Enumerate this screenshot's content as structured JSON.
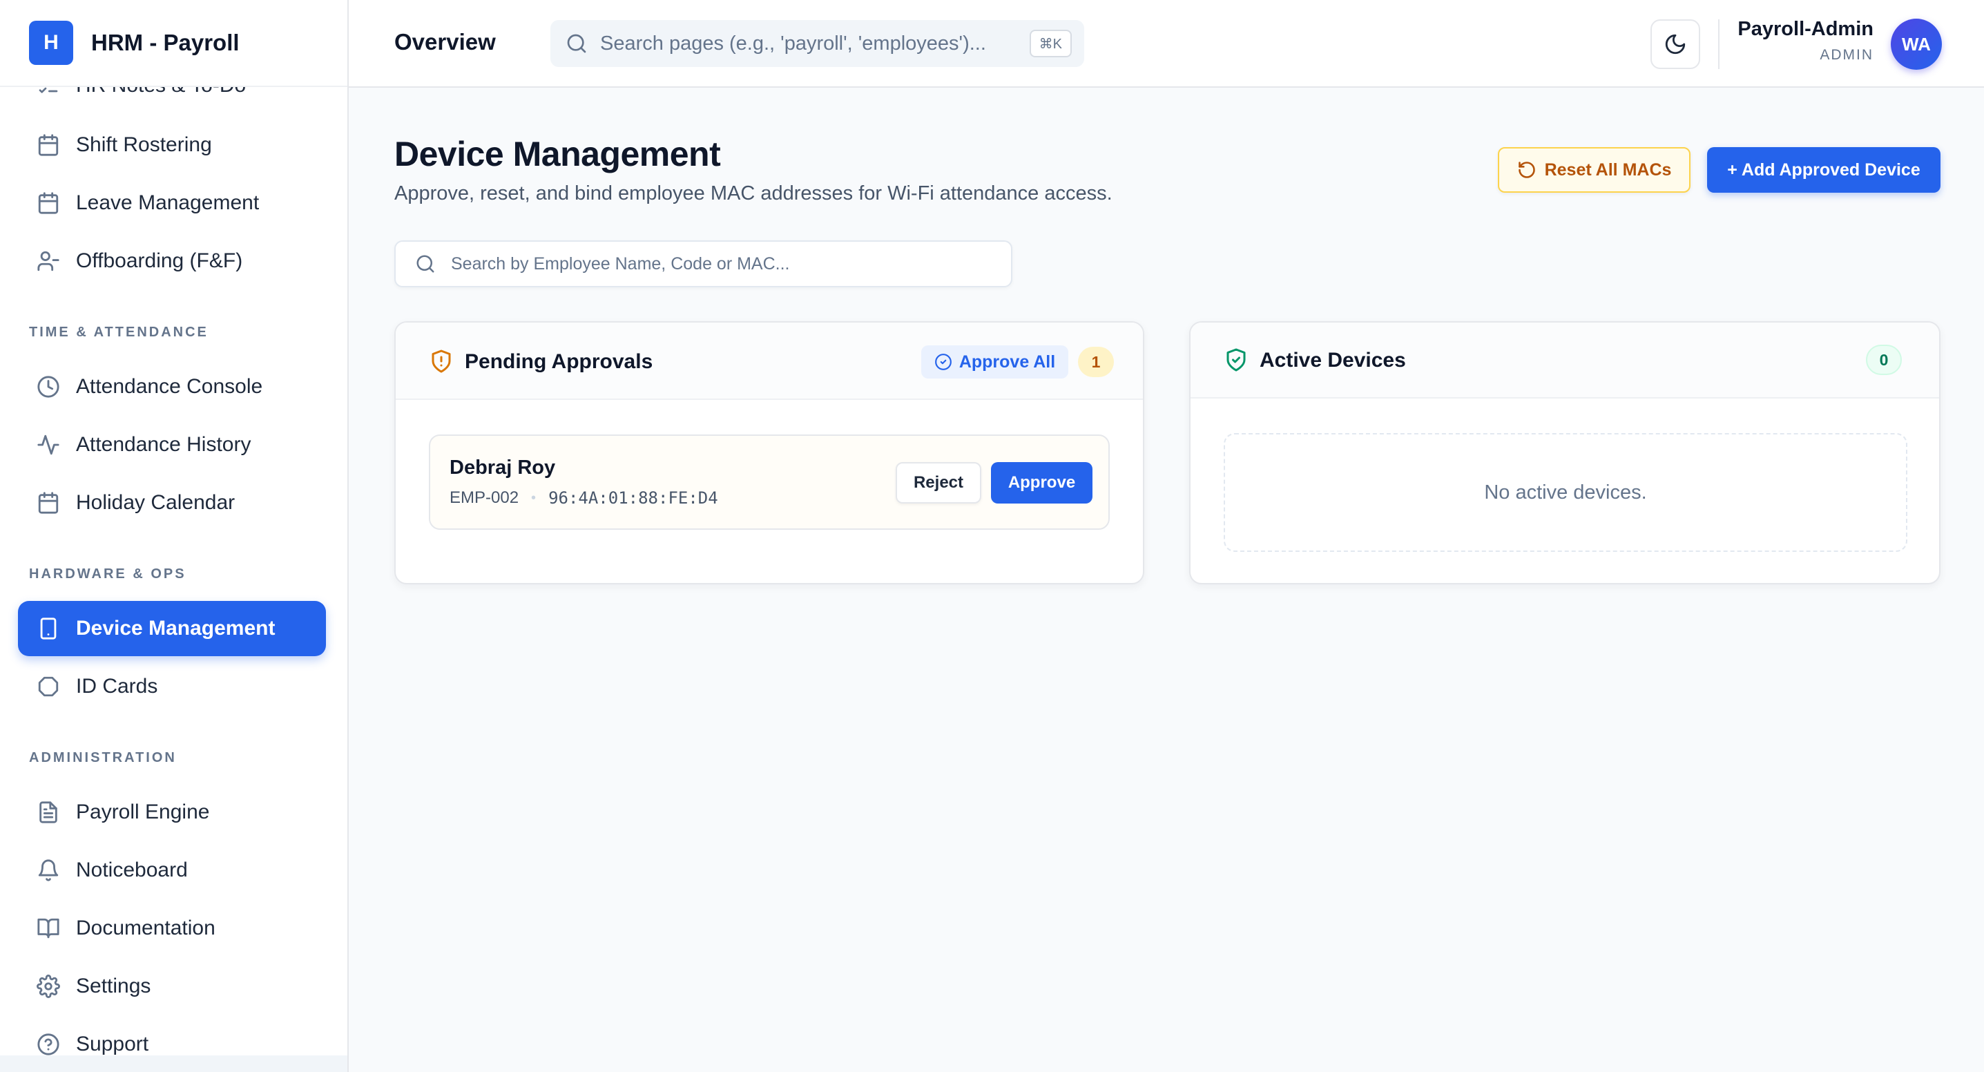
{
  "brand": {
    "logo_letter": "H",
    "name": "HRM - Payroll"
  },
  "sidebar": {
    "partial_item": "HR Notes & To-Do",
    "items_top": [
      {
        "label": "Shift Rostering",
        "icon": "calendar-icon"
      },
      {
        "label": "Leave Management",
        "icon": "calendar-icon"
      },
      {
        "label": "Offboarding (F&F)",
        "icon": "user-minus-icon"
      }
    ],
    "sections": [
      {
        "label": "TIME & ATTENDANCE",
        "items": [
          {
            "label": "Attendance Console",
            "icon": "clock-icon"
          },
          {
            "label": "Attendance History",
            "icon": "activity-icon"
          },
          {
            "label": "Holiday Calendar",
            "icon": "calendar-icon"
          }
        ]
      },
      {
        "label": "HARDWARE & OPS",
        "items": [
          {
            "label": "Device Management",
            "icon": "tablet-icon",
            "active": true
          },
          {
            "label": "ID Cards",
            "icon": "circle-icon"
          }
        ]
      },
      {
        "label": "ADMINISTRATION",
        "items": [
          {
            "label": "Payroll Engine",
            "icon": "file-text-icon"
          },
          {
            "label": "Noticeboard",
            "icon": "bell-icon"
          },
          {
            "label": "Documentation",
            "icon": "book-icon"
          },
          {
            "label": "Settings",
            "icon": "gear-icon"
          },
          {
            "label": "Support",
            "icon": "help-circle-icon"
          }
        ]
      }
    ]
  },
  "header": {
    "title": "Overview",
    "search_placeholder": "Search pages (e.g., 'payroll', 'employees')...",
    "search_shortcut": "⌘K",
    "theme_icon": "moon-icon",
    "user": {
      "name": "Payroll-Admin",
      "role": "ADMIN",
      "initials": "WA"
    }
  },
  "page": {
    "title": "Device Management",
    "subtitle": "Approve, reset, and bind employee MAC addresses for Wi-Fi attendance access.",
    "reset_button": "Reset All MACs",
    "add_button": "+ Add Approved Device",
    "search_placeholder": "Search by Employee Name, Code or MAC..."
  },
  "pending": {
    "title": "Pending Approvals",
    "approve_all": "Approve All",
    "count": "1",
    "rows": [
      {
        "name": "Debraj Roy",
        "code": "EMP-002",
        "separator": "•",
        "mac": "96:4A:01:88:FE:D4",
        "reject": "Reject",
        "approve": "Approve"
      }
    ]
  },
  "active": {
    "title": "Active Devices",
    "count": "0",
    "empty_text": "No active devices."
  },
  "colors": {
    "primary": "#2563eb",
    "warning": "#b45309",
    "success": "#059669",
    "avatar": "#4f46e5"
  }
}
